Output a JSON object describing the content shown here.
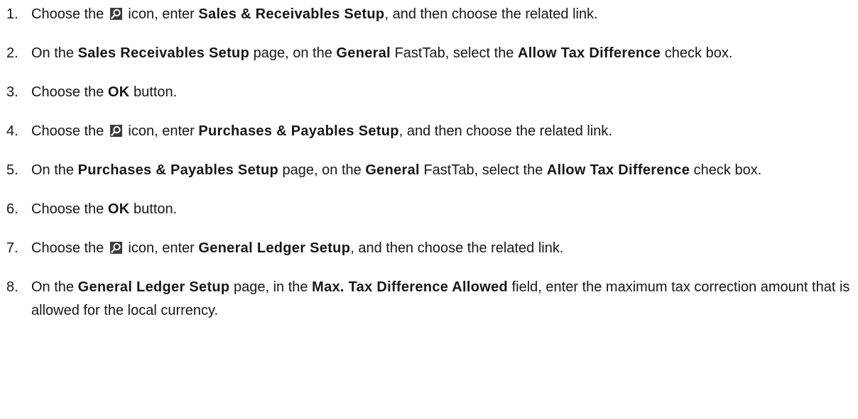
{
  "search_icon": "search-icon",
  "steps": [
    {
      "n": "1.",
      "parts": [
        {
          "t": "Choose the "
        },
        {
          "icon": true
        },
        {
          "t": " icon, enter "
        },
        {
          "b": "Sales & Receivables Setup"
        },
        {
          "t": ", and then choose the related link."
        }
      ]
    },
    {
      "n": "2.",
      "parts": [
        {
          "t": "On the "
        },
        {
          "b": "Sales Receivables Setup"
        },
        {
          "t": " page, on the "
        },
        {
          "b": "General"
        },
        {
          "t": " FastTab, select the "
        },
        {
          "b": "Allow Tax Difference"
        },
        {
          "t": " check box."
        }
      ]
    },
    {
      "n": "3.",
      "parts": [
        {
          "t": "Choose the "
        },
        {
          "b": "OK"
        },
        {
          "t": " button."
        }
      ]
    },
    {
      "n": "4.",
      "parts": [
        {
          "t": "Choose the "
        },
        {
          "icon": true
        },
        {
          "t": " icon, enter "
        },
        {
          "b": "Purchases & Payables Setup"
        },
        {
          "t": ", and then choose the related link."
        }
      ]
    },
    {
      "n": "5.",
      "parts": [
        {
          "t": "On the "
        },
        {
          "b": "Purchases & Payables Setup"
        },
        {
          "t": " page, on the "
        },
        {
          "b": "General"
        },
        {
          "t": " FastTab, select the "
        },
        {
          "b": "Allow Tax Difference"
        },
        {
          "t": " check box."
        }
      ]
    },
    {
      "n": "6.",
      "parts": [
        {
          "t": "Choose the "
        },
        {
          "b": "OK"
        },
        {
          "t": " button."
        }
      ]
    },
    {
      "n": "7.",
      "parts": [
        {
          "t": "Choose the "
        },
        {
          "icon": true
        },
        {
          "t": " icon, enter "
        },
        {
          "b": "General Ledger Setup"
        },
        {
          "t": ", and then choose the related link."
        }
      ]
    },
    {
      "n": "8.",
      "parts": [
        {
          "t": "On the "
        },
        {
          "b": "General Ledger Setup"
        },
        {
          "t": " page, in the "
        },
        {
          "b": "Max. Tax Difference Allowed"
        },
        {
          "t": " field, enter the maximum tax correction amount that is allowed for the local currency."
        }
      ]
    }
  ]
}
